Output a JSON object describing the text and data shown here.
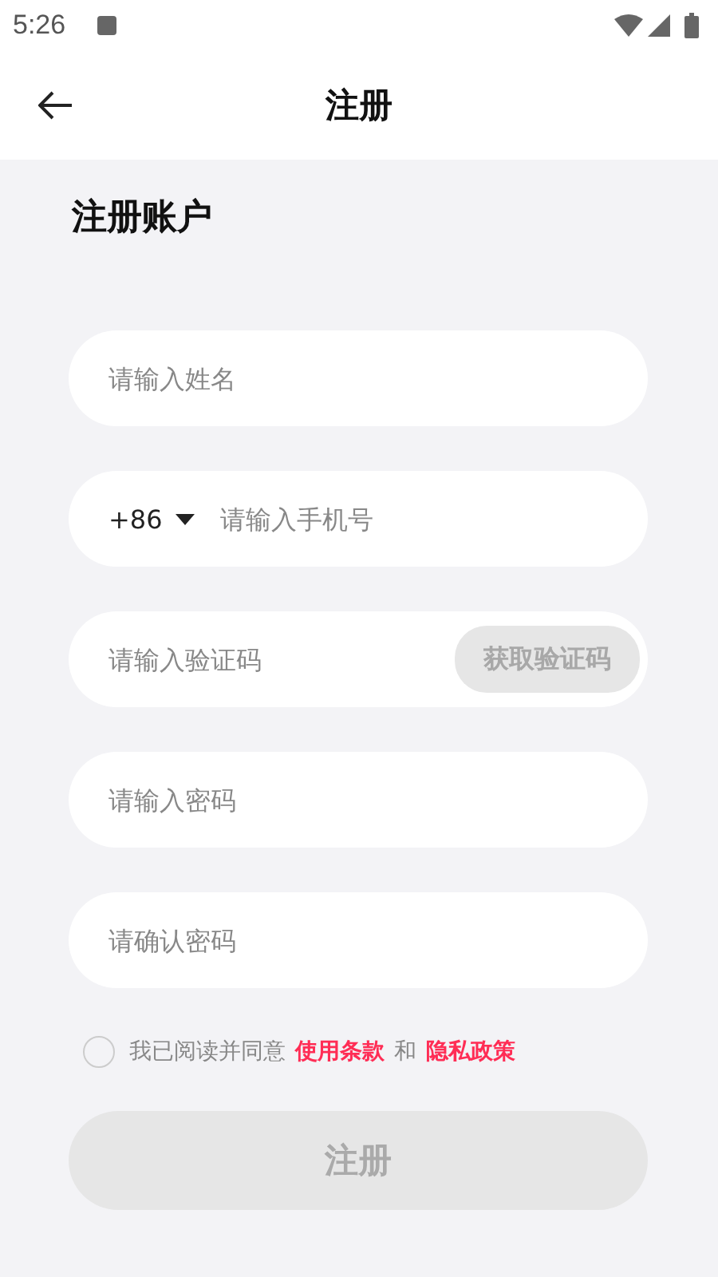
{
  "status_bar": {
    "time": "5:26"
  },
  "header": {
    "title": "注册"
  },
  "form": {
    "heading": "注册账户",
    "fields": [
      {
        "kind": "text",
        "placeholder": "请输入姓名"
      },
      {
        "kind": "phone",
        "country_code": "+86",
        "placeholder": "请输入手机号"
      },
      {
        "kind": "code",
        "placeholder": "请输入验证码",
        "button": "获取验证码",
        "button_disabled": true
      },
      {
        "kind": "password",
        "placeholder": "请输入密码"
      },
      {
        "kind": "password",
        "placeholder": "请确认密码"
      }
    ],
    "agreement": {
      "checked": false,
      "text": "我已阅读并同意",
      "terms": "使用条款",
      "joiner": "和",
      "privacy": "隐私政策"
    },
    "submit": {
      "label": "注册",
      "disabled": true
    }
  }
}
